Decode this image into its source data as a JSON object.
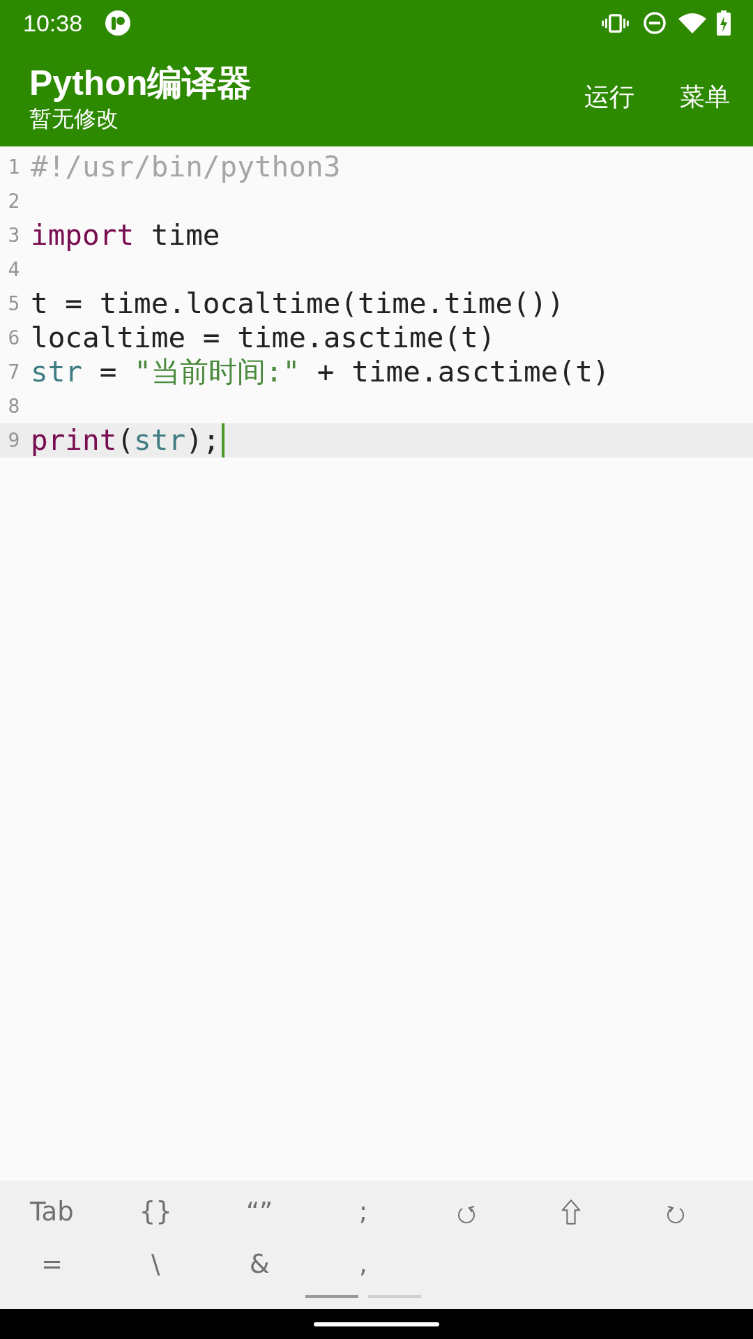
{
  "status_bar": {
    "time": "10:38"
  },
  "app_bar": {
    "title": "Python编译器",
    "subtitle": "暂无修改",
    "actions": [
      "运行",
      "菜单"
    ]
  },
  "editor": {
    "lines": [
      {
        "number": "1",
        "selected": false,
        "tokens": [
          {
            "kind": "comment",
            "text": "#!/usr/bin/python3"
          }
        ]
      },
      {
        "number": "2",
        "selected": false
      },
      {
        "number": "3",
        "selected": false,
        "tokens": [
          {
            "kind": "keyword",
            "text": "import"
          },
          {
            "kind": "plain",
            "text": " time"
          }
        ]
      },
      {
        "number": "4",
        "selected": false
      },
      {
        "number": "5",
        "selected": false,
        "tokens": [
          {
            "kind": "plain",
            "text": "t = time.localtime(time.time())"
          }
        ]
      },
      {
        "number": "6",
        "selected": false,
        "tokens": [
          {
            "kind": "plain",
            "text": "localtime = time.asctime(t)"
          }
        ]
      },
      {
        "number": "7",
        "selected": false,
        "tokens": [
          {
            "kind": "builtin",
            "text": "str"
          },
          {
            "kind": "plain",
            "text": " = "
          },
          {
            "kind": "string",
            "text": "\"当前时间:\""
          },
          {
            "kind": "plain",
            "text": " + time.asctime(t)"
          }
        ]
      },
      {
        "number": "8",
        "selected": false
      },
      {
        "number": "9",
        "selected": true,
        "tokens": [
          {
            "kind": "keyword",
            "text": "print"
          },
          {
            "kind": "plain",
            "text": "("
          },
          {
            "kind": "builtin",
            "text": "str"
          },
          {
            "kind": "plain",
            "text": ");"
          }
        ]
      }
    ]
  },
  "key_bar": {
    "rows": [
      {
        "keys": [
          {
            "kind": "text",
            "label": "Tab"
          },
          {
            "kind": "text",
            "label": "{}"
          },
          {
            "kind": "text",
            "label": "“”"
          },
          {
            "kind": "text",
            "label": ";"
          },
          {
            "kind": "undo"
          },
          {
            "kind": "shift"
          },
          {
            "kind": "redo"
          }
        ]
      },
      {
        "keys": [
          {
            "kind": "text",
            "label": "="
          },
          {
            "kind": "text",
            "label": "\\"
          },
          {
            "kind": "text",
            "label": "&"
          },
          {
            "kind": "text",
            "label": ","
          }
        ]
      }
    ],
    "pages": [
      {
        "selected": true
      },
      {
        "selected": false
      }
    ]
  }
}
